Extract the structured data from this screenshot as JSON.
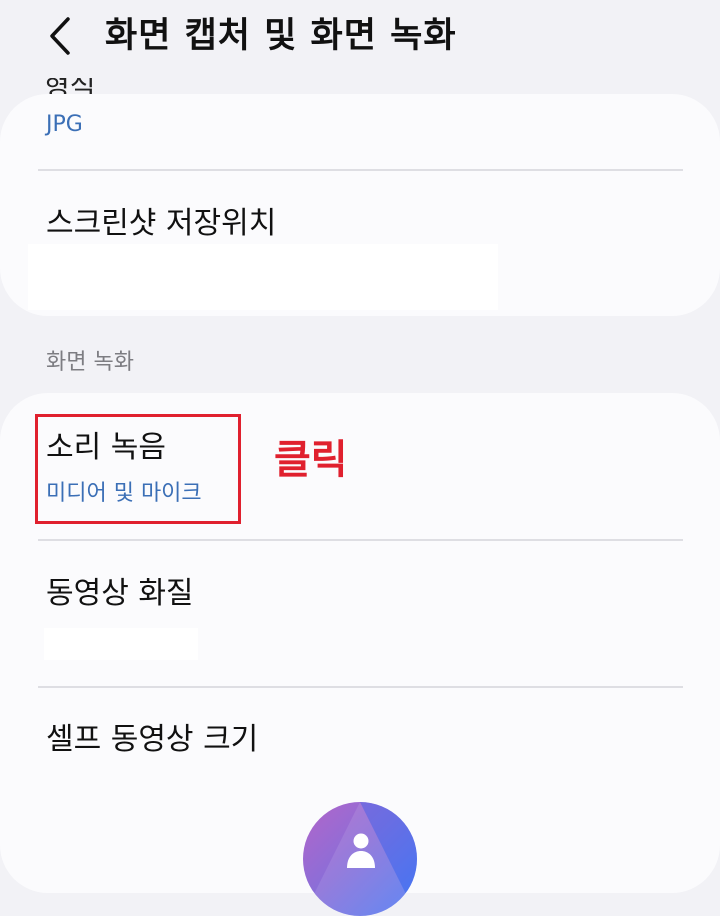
{
  "header": {
    "title": "화면 캡처 및 화면 녹화"
  },
  "screenshot_section": {
    "cutoff_label": "형식",
    "format_value": "JPG",
    "save_location_label": "스크린샷 저장위치"
  },
  "screen_recording_section": {
    "header": "화면 녹화",
    "items": [
      {
        "title": "소리 녹음",
        "subtitle": "미디어 및 마이크"
      },
      {
        "title": "동영상 화질"
      },
      {
        "title": "셀프 동영상 크기"
      }
    ]
  },
  "annotation": {
    "label": "클릭",
    "color": "#e0202e"
  },
  "colors": {
    "accent_blue": "#3b6fb6",
    "background": "#f2f2f6",
    "card": "#fbfbfd"
  },
  "icons": {
    "back": "chevron-left-icon",
    "fab": "person-icon"
  }
}
